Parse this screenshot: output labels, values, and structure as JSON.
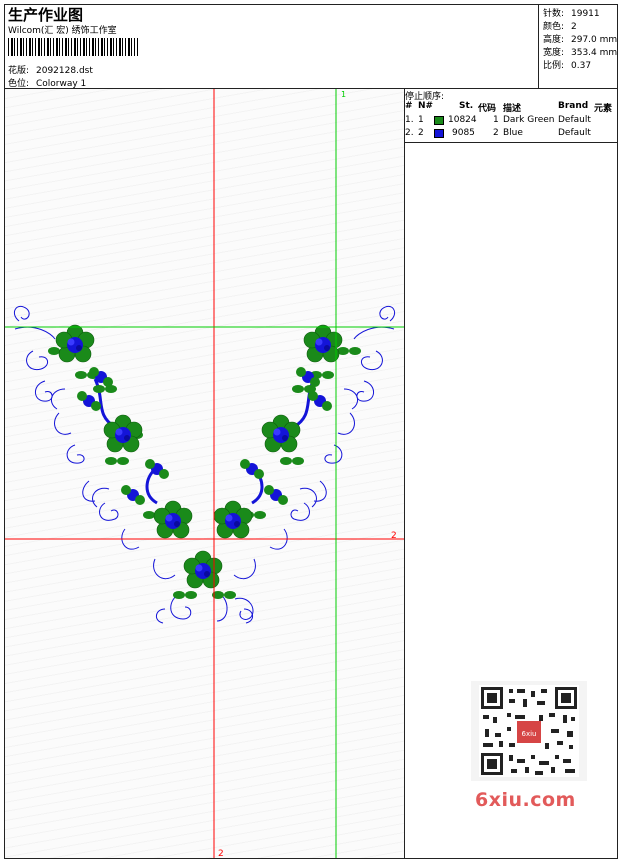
{
  "header": {
    "title": "生产作业图",
    "subtitle": "Wilcom(汇 宏) 绣饰工作室",
    "design_label": "花版:",
    "design_value": "2092128.dst",
    "colorway_label": "色位:",
    "colorway_value": "Colorway 1"
  },
  "stats": [
    {
      "label": "针数:",
      "value": "19911"
    },
    {
      "label": "颜色:",
      "value": "2"
    },
    {
      "label": "高度:",
      "value": "297.0 mm"
    },
    {
      "label": "宽度:",
      "value": "353.4 mm"
    },
    {
      "label": "比例:",
      "value": "0.37"
    }
  ],
  "stop_sequence": {
    "title": "停止顺序:",
    "columns": {
      "hash": "#",
      "n": "N#",
      "st": "St.",
      "code": "代码",
      "desc": "描述",
      "brand": "Brand",
      "element": "元素"
    },
    "rows": [
      {
        "index": "1.",
        "n": "1",
        "st": "10824",
        "code": "1",
        "desc": "Dark Green",
        "brand": "Default",
        "color": "#1a8a1a"
      },
      {
        "index": "2.",
        "n": "2",
        "st": "9085",
        "code": "2",
        "desc": "Blue",
        "brand": "Default",
        "color": "#1414d8"
      }
    ]
  },
  "canvas": {
    "marker_green": "1",
    "marker_red_h": "2",
    "marker_red_v": "2",
    "thread_green": "#1a8a1a",
    "thread_blue": "#1414d8",
    "guide_red": "#ff0000",
    "guide_green": "#00cc00"
  },
  "watermark": {
    "text": "6xiu.com",
    "qr_badge": "6xiu"
  }
}
